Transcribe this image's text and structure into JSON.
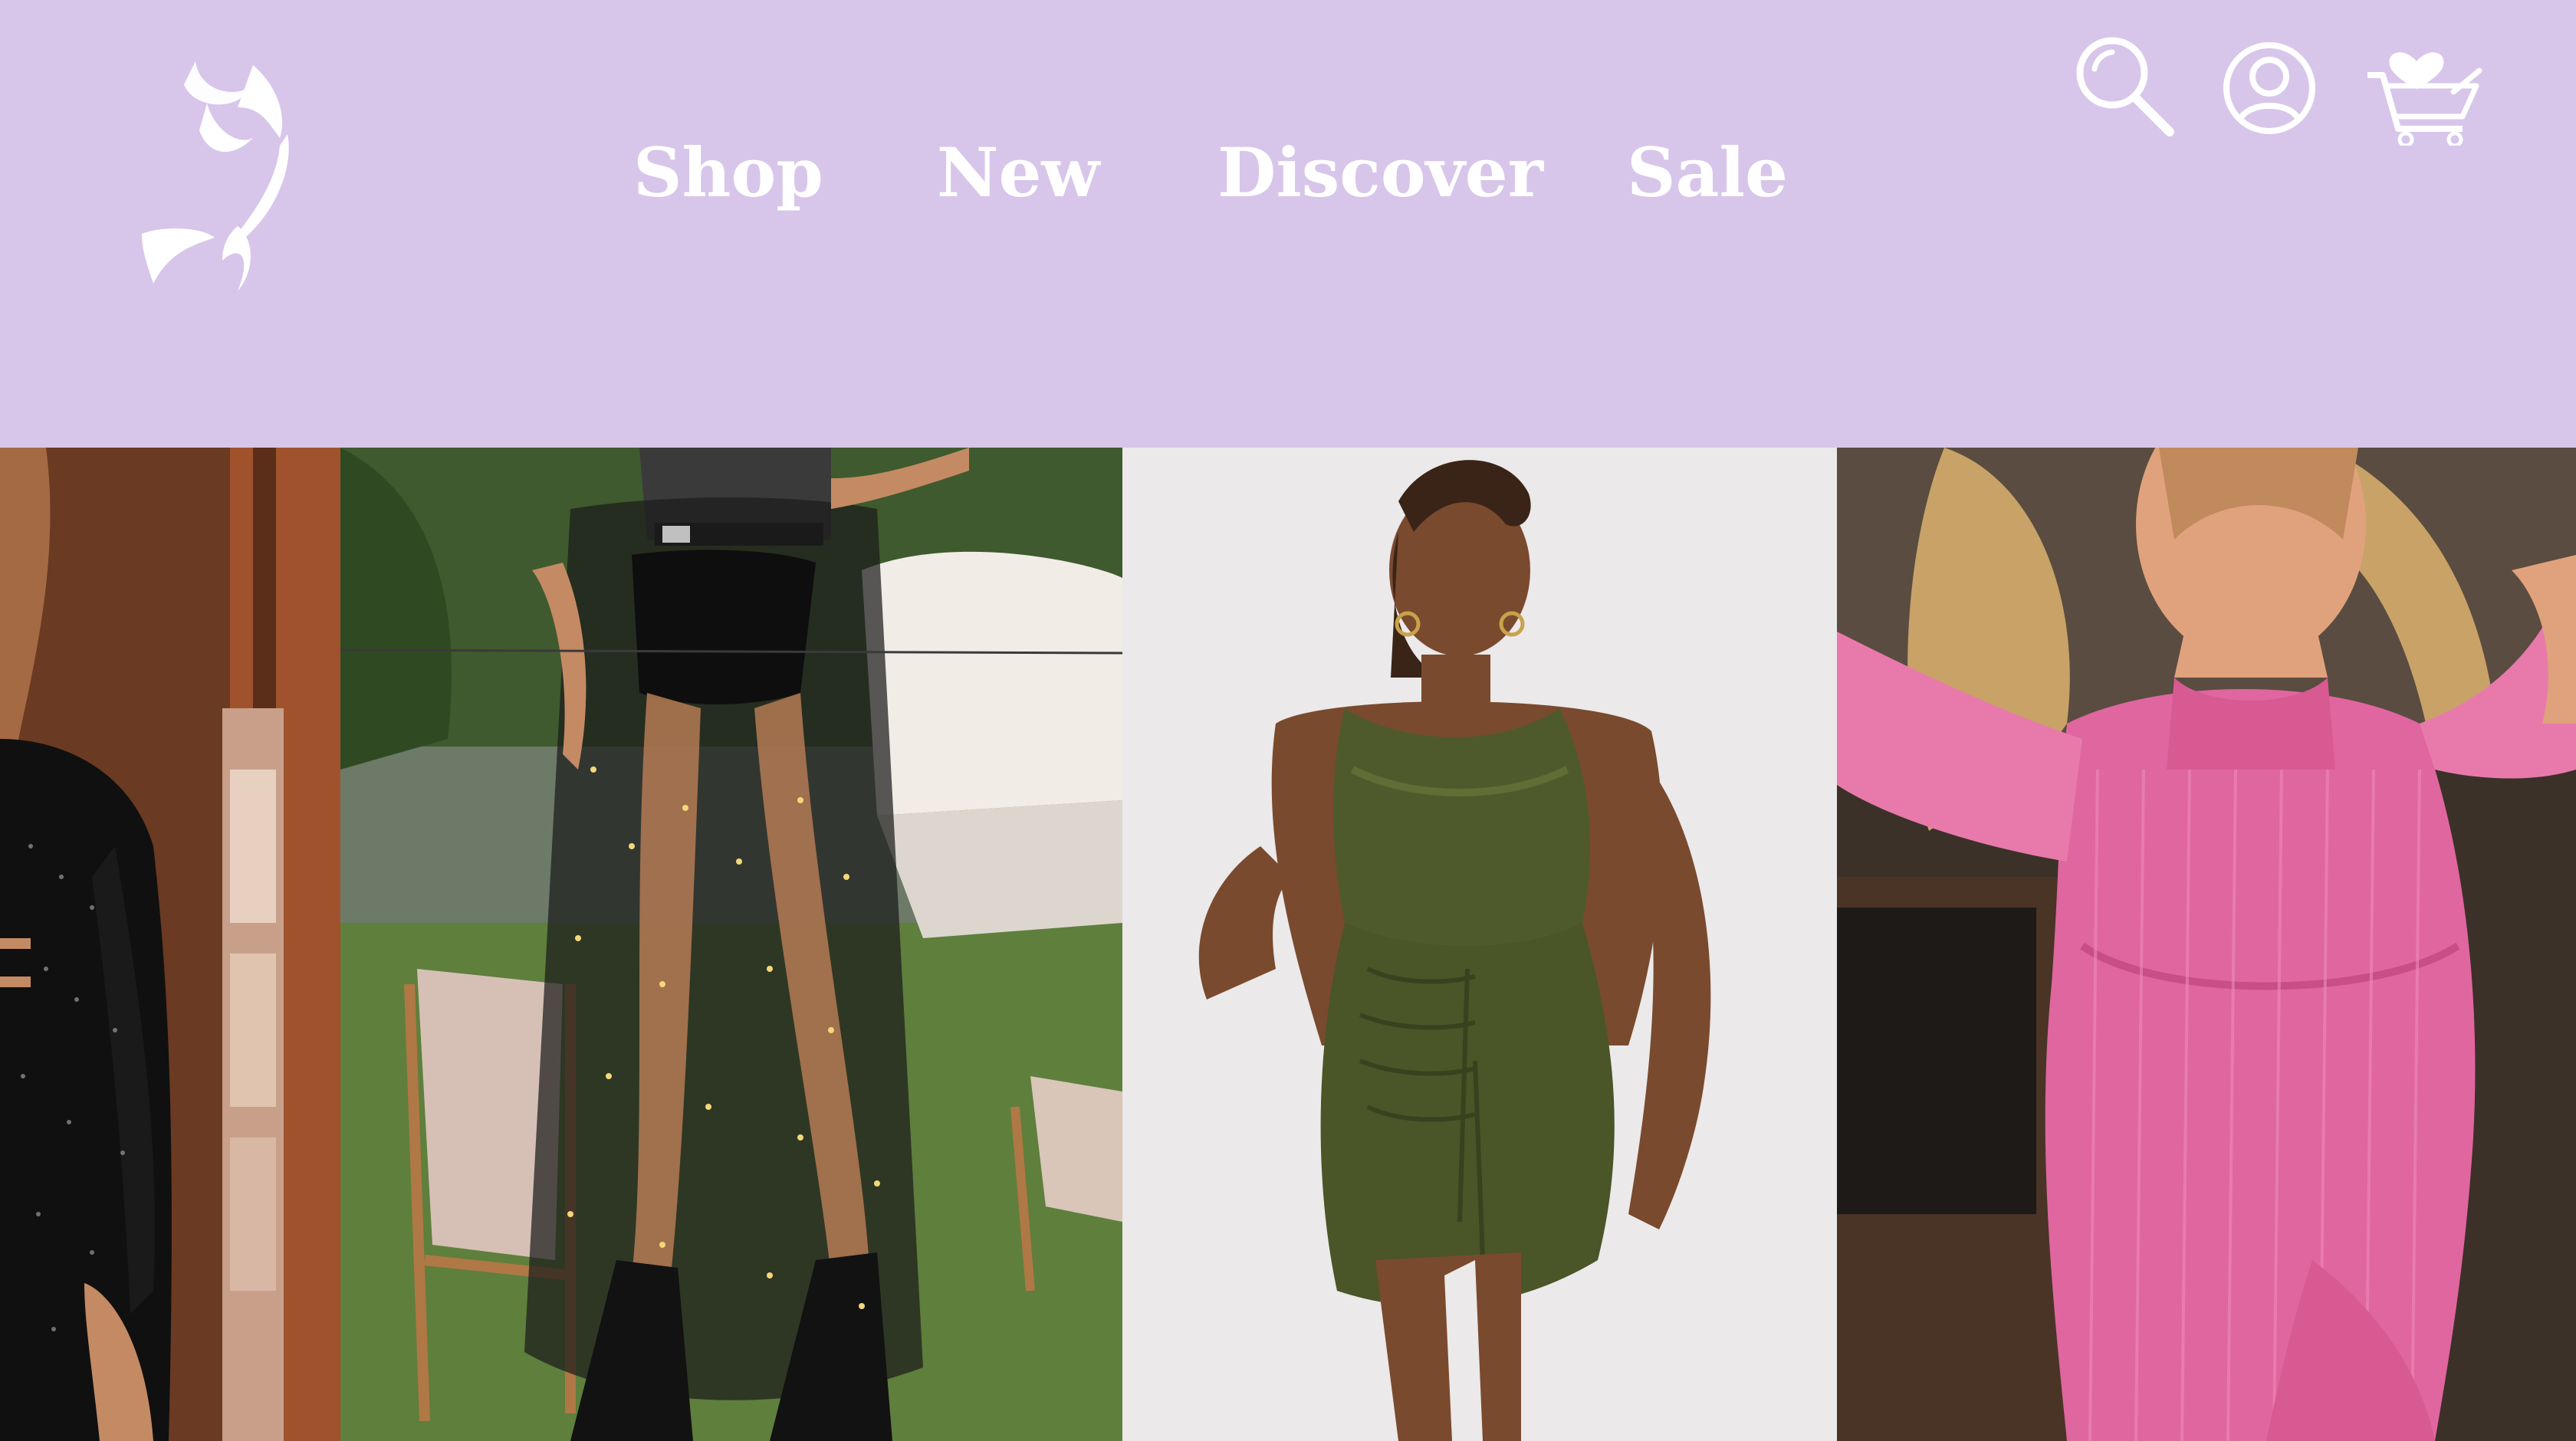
{
  "header": {
    "background": "#d7c6ea",
    "logo": {
      "icon": "brand-logo-icon"
    },
    "nav": {
      "shop": "Shop",
      "new": "New",
      "discover": "Discover",
      "sale": "Sale"
    },
    "icons": {
      "search": "search-icon",
      "account": "account-icon",
      "cart": "cart-wishlist-icon"
    }
  },
  "gallery": {
    "photos": [
      {
        "subject": "black-sequin-outfit-photo"
      },
      {
        "subject": "sheer-star-tulle-skirt-photo"
      },
      {
        "subject": "olive-satin-ruched-dress-photo"
      },
      {
        "subject": "pink-ribbed-bodysuit-photo"
      }
    ]
  }
}
